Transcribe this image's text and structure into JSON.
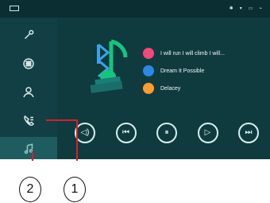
{
  "tracks": [
    {
      "title": "I will run I will climb I will...",
      "color": "#f2487a"
    },
    {
      "title": "Dream It Possible",
      "color": "#2f86e6"
    },
    {
      "title": "Delacey",
      "color": "#ff9b2f"
    }
  ],
  "callouts": [
    {
      "label": "1"
    },
    {
      "label": "2"
    }
  ],
  "icons": {
    "sidebar": [
      "wrench-icon",
      "keypad-icon",
      "person-icon",
      "call-settings-icon",
      "music-icon"
    ],
    "controls": [
      "volume-icon",
      "previous-icon",
      "pause-icon",
      "play-icon",
      "next-icon"
    ]
  }
}
